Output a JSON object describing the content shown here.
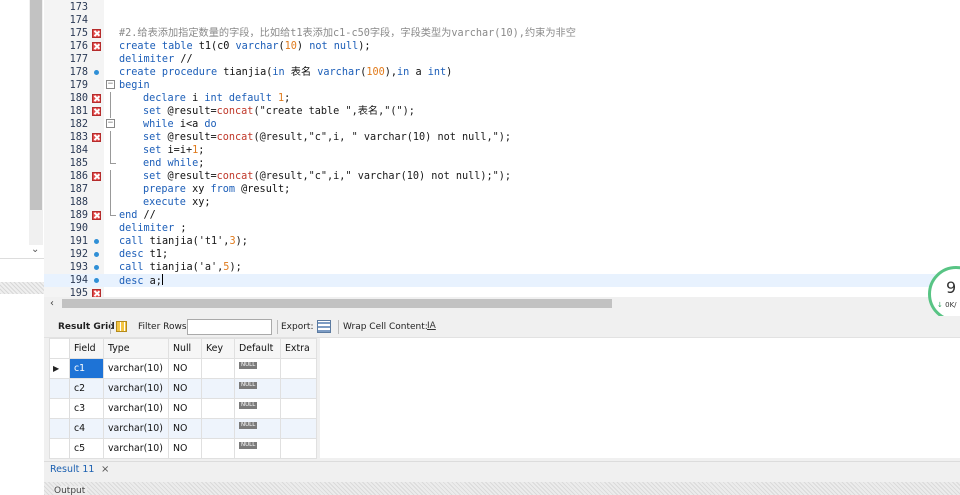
{
  "editor": {
    "lines": [
      {
        "n": "173",
        "marker": "",
        "fold": "",
        "indent": 0,
        "tokens": []
      },
      {
        "n": "174",
        "marker": "",
        "fold": "",
        "indent": 0,
        "tokens": []
      },
      {
        "n": "175",
        "marker": "err",
        "fold": "",
        "indent": 0,
        "tokens": [
          {
            "c": "t-cm",
            "t": "#2.给表添加指定数量的字段，比如给t1表添加c1-c50字段，字段类型为varchar(10),约束为非空"
          }
        ]
      },
      {
        "n": "176",
        "marker": "err",
        "fold": "",
        "indent": 0,
        "tokens": [
          {
            "c": "t-kw",
            "t": "create table "
          },
          {
            "c": "t-id",
            "t": "t1(c0 "
          },
          {
            "c": "t-kw",
            "t": "varchar"
          },
          {
            "c": "t-id",
            "t": "("
          },
          {
            "c": "t-num",
            "t": "10"
          },
          {
            "c": "t-id",
            "t": ") "
          },
          {
            "c": "t-kw",
            "t": "not null"
          },
          {
            "c": "t-id",
            "t": ");"
          }
        ]
      },
      {
        "n": "177",
        "marker": "",
        "fold": "",
        "indent": 0,
        "tokens": [
          {
            "c": "t-kw",
            "t": "delimiter "
          },
          {
            "c": "t-id",
            "t": "//"
          }
        ]
      },
      {
        "n": "178",
        "marker": "ok",
        "fold": "",
        "indent": 0,
        "tokens": [
          {
            "c": "t-kw",
            "t": "create procedure "
          },
          {
            "c": "t-id",
            "t": "tianjia("
          },
          {
            "c": "t-kw",
            "t": "in "
          },
          {
            "c": "t-id",
            "t": "表名 "
          },
          {
            "c": "t-kw",
            "t": "varchar"
          },
          {
            "c": "t-id",
            "t": "("
          },
          {
            "c": "t-num",
            "t": "100"
          },
          {
            "c": "t-id",
            "t": "),"
          },
          {
            "c": "t-kw",
            "t": "in "
          },
          {
            "c": "t-id",
            "t": "a "
          },
          {
            "c": "t-kw",
            "t": "int"
          },
          {
            "c": "t-id",
            "t": ")"
          }
        ]
      },
      {
        "n": "179",
        "marker": "",
        "fold": "box",
        "indent": 0,
        "tokens": [
          {
            "c": "t-kw",
            "t": "begin"
          }
        ]
      },
      {
        "n": "180",
        "marker": "err",
        "fold": "vline",
        "indent": 1,
        "tokens": [
          {
            "c": "t-kw",
            "t": "declare "
          },
          {
            "c": "t-id",
            "t": "i "
          },
          {
            "c": "t-kw",
            "t": "int default "
          },
          {
            "c": "t-num",
            "t": "1"
          },
          {
            "c": "t-id",
            "t": ";"
          }
        ]
      },
      {
        "n": "181",
        "marker": "err",
        "fold": "vline",
        "indent": 1,
        "tokens": [
          {
            "c": "t-kw",
            "t": "set "
          },
          {
            "c": "t-id",
            "t": "@result="
          },
          {
            "c": "t-fn",
            "t": "concat"
          },
          {
            "c": "t-str",
            "t": "(\"create table \",表名,\"(\");"
          }
        ]
      },
      {
        "n": "182",
        "marker": "",
        "fold": "box",
        "indent": 1,
        "tokens": [
          {
            "c": "t-kw",
            "t": "while "
          },
          {
            "c": "t-id",
            "t": "i<a "
          },
          {
            "c": "t-kw",
            "t": "do"
          }
        ]
      },
      {
        "n": "183",
        "marker": "err",
        "fold": "vline",
        "indent": 1,
        "tokens": [
          {
            "c": "t-kw",
            "t": "set "
          },
          {
            "c": "t-id",
            "t": "@result="
          },
          {
            "c": "t-fn",
            "t": "concat"
          },
          {
            "c": "t-str",
            "t": "(@result,\"c\",i, \" varchar(10) not null,\");"
          }
        ]
      },
      {
        "n": "184",
        "marker": "",
        "fold": "vline",
        "indent": 1,
        "tokens": [
          {
            "c": "t-kw",
            "t": "set "
          },
          {
            "c": "t-id",
            "t": "i=i+"
          },
          {
            "c": "t-num",
            "t": "1"
          },
          {
            "c": "t-id",
            "t": ";"
          }
        ]
      },
      {
        "n": "185",
        "marker": "",
        "fold": "endl",
        "indent": 1,
        "tokens": [
          {
            "c": "t-kw",
            "t": "end while"
          },
          {
            "c": "t-id",
            "t": ";"
          }
        ]
      },
      {
        "n": "186",
        "marker": "err",
        "fold": "vline",
        "indent": 1,
        "tokens": [
          {
            "c": "t-kw",
            "t": "set "
          },
          {
            "c": "t-id",
            "t": "@result="
          },
          {
            "c": "t-fn",
            "t": "concat"
          },
          {
            "c": "t-str",
            "t": "(@result,\"c\",i,\" varchar(10) not null);\");"
          }
        ]
      },
      {
        "n": "187",
        "marker": "",
        "fold": "vline",
        "indent": 1,
        "tokens": [
          {
            "c": "t-kw",
            "t": "prepare "
          },
          {
            "c": "t-id",
            "t": "xy "
          },
          {
            "c": "t-kw",
            "t": "from "
          },
          {
            "c": "t-id",
            "t": "@result;"
          }
        ]
      },
      {
        "n": "188",
        "marker": "",
        "fold": "vline",
        "indent": 1,
        "tokens": [
          {
            "c": "t-kw",
            "t": "execute "
          },
          {
            "c": "t-id",
            "t": "xy;"
          }
        ]
      },
      {
        "n": "189",
        "marker": "err",
        "fold": "endl",
        "indent": 0,
        "tokens": [
          {
            "c": "t-kw",
            "t": "end "
          },
          {
            "c": "t-id",
            "t": "//"
          }
        ]
      },
      {
        "n": "190",
        "marker": "",
        "fold": "",
        "indent": 0,
        "tokens": [
          {
            "c": "t-kw",
            "t": "delimiter "
          },
          {
            "c": "t-id",
            "t": ";"
          }
        ]
      },
      {
        "n": "191",
        "marker": "ok",
        "fold": "",
        "indent": 0,
        "tokens": [
          {
            "c": "t-kw",
            "t": "call "
          },
          {
            "c": "t-id",
            "t": "tianjia("
          },
          {
            "c": "t-str",
            "t": "'t1'"
          },
          {
            "c": "t-id",
            "t": ","
          },
          {
            "c": "t-num",
            "t": "3"
          },
          {
            "c": "t-id",
            "t": ");"
          }
        ]
      },
      {
        "n": "192",
        "marker": "ok",
        "fold": "",
        "indent": 0,
        "tokens": [
          {
            "c": "t-kw",
            "t": "desc "
          },
          {
            "c": "t-id",
            "t": "t1;"
          }
        ]
      },
      {
        "n": "193",
        "marker": "ok",
        "fold": "",
        "indent": 0,
        "tokens": [
          {
            "c": "t-kw",
            "t": "call "
          },
          {
            "c": "t-id",
            "t": "tianjia("
          },
          {
            "c": "t-str",
            "t": "'a'"
          },
          {
            "c": "t-id",
            "t": ","
          },
          {
            "c": "t-num",
            "t": "5"
          },
          {
            "c": "t-id",
            "t": ");"
          }
        ]
      },
      {
        "n": "194",
        "marker": "ok",
        "fold": "",
        "indent": 0,
        "current": true,
        "tokens": [
          {
            "c": "t-kw",
            "t": "desc "
          },
          {
            "c": "t-id",
            "t": "a;"
          }
        ]
      },
      {
        "n": "195",
        "marker": "err",
        "fold": "",
        "indent": 0,
        "tokens": []
      }
    ]
  },
  "speed_widget": {
    "value": "9",
    "unit": "%",
    "sub": "0K/"
  },
  "toolbar": {
    "result_grid": "Result Grid",
    "filter_rows": "Filter Rows:",
    "filter_value": "",
    "export": "Export:",
    "wrap_cell": "Wrap Cell Content:",
    "wrap_icon": "IA"
  },
  "grid": {
    "columns": [
      "Field",
      "Type",
      "Null",
      "Key",
      "Default",
      "Extra"
    ],
    "null_badge": "NULL",
    "rows": [
      {
        "field": "c1",
        "type": "varchar(10)",
        "null": "NO",
        "key": "",
        "extra": ""
      },
      {
        "field": "c2",
        "type": "varchar(10)",
        "null": "NO",
        "key": "",
        "extra": ""
      },
      {
        "field": "c3",
        "type": "varchar(10)",
        "null": "NO",
        "key": "",
        "extra": ""
      },
      {
        "field": "c4",
        "type": "varchar(10)",
        "null": "NO",
        "key": "",
        "extra": ""
      },
      {
        "field": "c5",
        "type": "varchar(10)",
        "null": "NO",
        "key": "",
        "extra": ""
      }
    ]
  },
  "tabs": {
    "result_tab": "Result 11",
    "close": "×"
  },
  "output": {
    "label": "Output"
  },
  "icons": {
    "scroll_left": "arrow-left-icon",
    "chevron": "chevron-down-icon",
    "row_pointer": "row-pointer-icon"
  }
}
